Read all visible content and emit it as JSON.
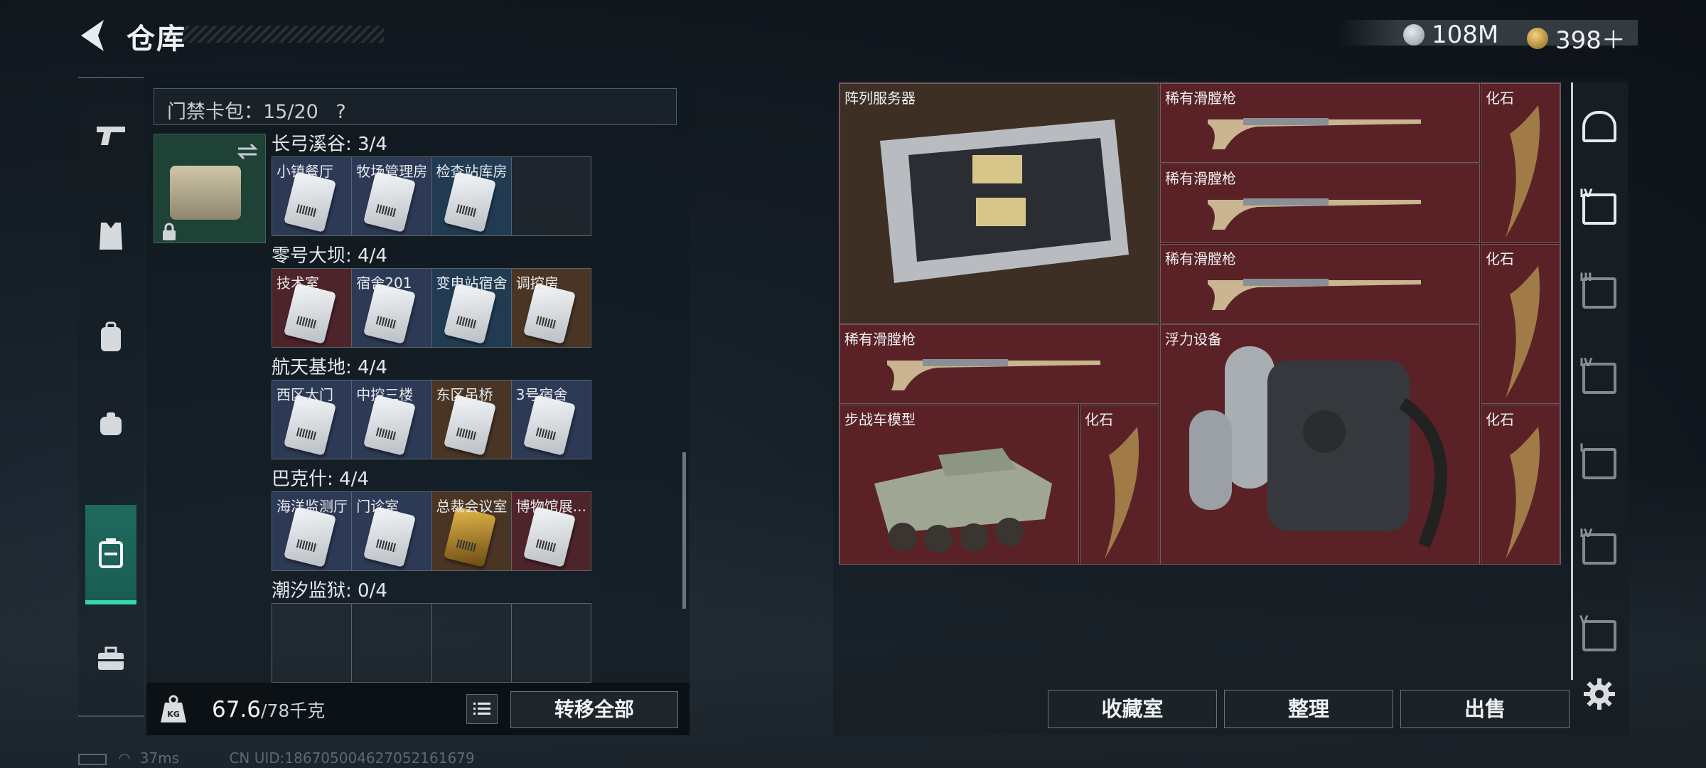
{
  "header": {
    "title": "仓库"
  },
  "currency": {
    "coins": "108M",
    "tokens": "398＋"
  },
  "left_nav": [
    {
      "icon": "pistol-icon"
    },
    {
      "icon": "vest-icon"
    },
    {
      "icon": "backpack-icon"
    },
    {
      "icon": "pouch-icon"
    },
    {
      "icon": "keycard-case-icon"
    },
    {
      "icon": "toolbox-icon"
    }
  ],
  "keycard": {
    "label": "门禁卡包：15/20",
    "help": "?"
  },
  "categories": [
    {
      "title": "长弓溪谷: 3/4",
      "slots": [
        {
          "name": "小镇餐厅",
          "color": "blue",
          "card": "white"
        },
        {
          "name": "牧场管理房",
          "color": "blue",
          "card": "white"
        },
        {
          "name": "检查站库房",
          "color": "steel",
          "card": "white"
        },
        {
          "name": "",
          "color": "empty",
          "card": ""
        }
      ]
    },
    {
      "title": "零号大坝: 4/4",
      "slots": [
        {
          "name": "技术室",
          "color": "red",
          "card": "white"
        },
        {
          "name": "宿舍201",
          "color": "blue",
          "card": "white"
        },
        {
          "name": "变电站宿舍",
          "color": "steel",
          "card": "white"
        },
        {
          "name": "调控房",
          "color": "brown",
          "card": "white"
        }
      ]
    },
    {
      "title": "航天基地: 4/4",
      "slots": [
        {
          "name": "西区大门",
          "color": "blue",
          "card": "white"
        },
        {
          "name": "中控三楼",
          "color": "blue",
          "card": "white"
        },
        {
          "name": "东区吊桥",
          "color": "brown",
          "card": "white"
        },
        {
          "name": "3号宿舍",
          "color": "blue",
          "card": "white"
        }
      ]
    },
    {
      "title": "巴克什: 4/4",
      "slots": [
        {
          "name": "海洋监测厅",
          "color": "blue",
          "card": "white"
        },
        {
          "name": "门诊室",
          "color": "blue",
          "card": "white"
        },
        {
          "name": "总裁会议室",
          "color": "brown",
          "card": "gold"
        },
        {
          "name": "博物馆展...",
          "color": "red",
          "card": "white"
        }
      ]
    },
    {
      "title": "潮汐监狱: 0/4",
      "slots": [
        {
          "name": "",
          "color": "empty",
          "card": ""
        },
        {
          "name": "",
          "color": "empty",
          "card": ""
        },
        {
          "name": "",
          "color": "empty",
          "card": ""
        },
        {
          "name": "",
          "color": "empty",
          "card": ""
        }
      ]
    }
  ],
  "weight": {
    "current": "67.6",
    "max": "/78千克"
  },
  "buttons": {
    "transfer_all": "转移全部",
    "collection": "收藏室",
    "sort": "整理",
    "sell": "出售"
  },
  "items": {
    "server": "阵列服务器",
    "musket1": "稀有滑膛枪",
    "musket2": "稀有滑膛枪",
    "musket3": "稀有滑膛枪",
    "musket4": "稀有滑膛枪",
    "fossil1": "化石",
    "fossil2": "化石",
    "fossil3": "化石",
    "fossil4": "化石",
    "flotation": "浮力设备",
    "ifv": "步战车模型"
  },
  "right_nav": [
    {
      "icon": "helmet-icon",
      "tier": ""
    },
    {
      "icon": "armor-repair-icon",
      "tier": "IV"
    },
    {
      "icon": "armor-repair-icon",
      "tier": "III"
    },
    {
      "icon": "armor-repair-icon",
      "tier": "IV"
    },
    {
      "icon": "helmet-repair-icon",
      "tier": "I"
    },
    {
      "icon": "armor-repair-icon",
      "tier": "IV"
    },
    {
      "icon": "armor-repair-icon",
      "tier": "V"
    }
  ],
  "status": {
    "ping": "37ms",
    "uid": "CN UID:186705004627052161679"
  },
  "colors": {
    "accent": "#38d6b0",
    "item_red": "#5a2227",
    "item_brown": "#3e2f25",
    "slot_blue": "#2d3a55"
  }
}
